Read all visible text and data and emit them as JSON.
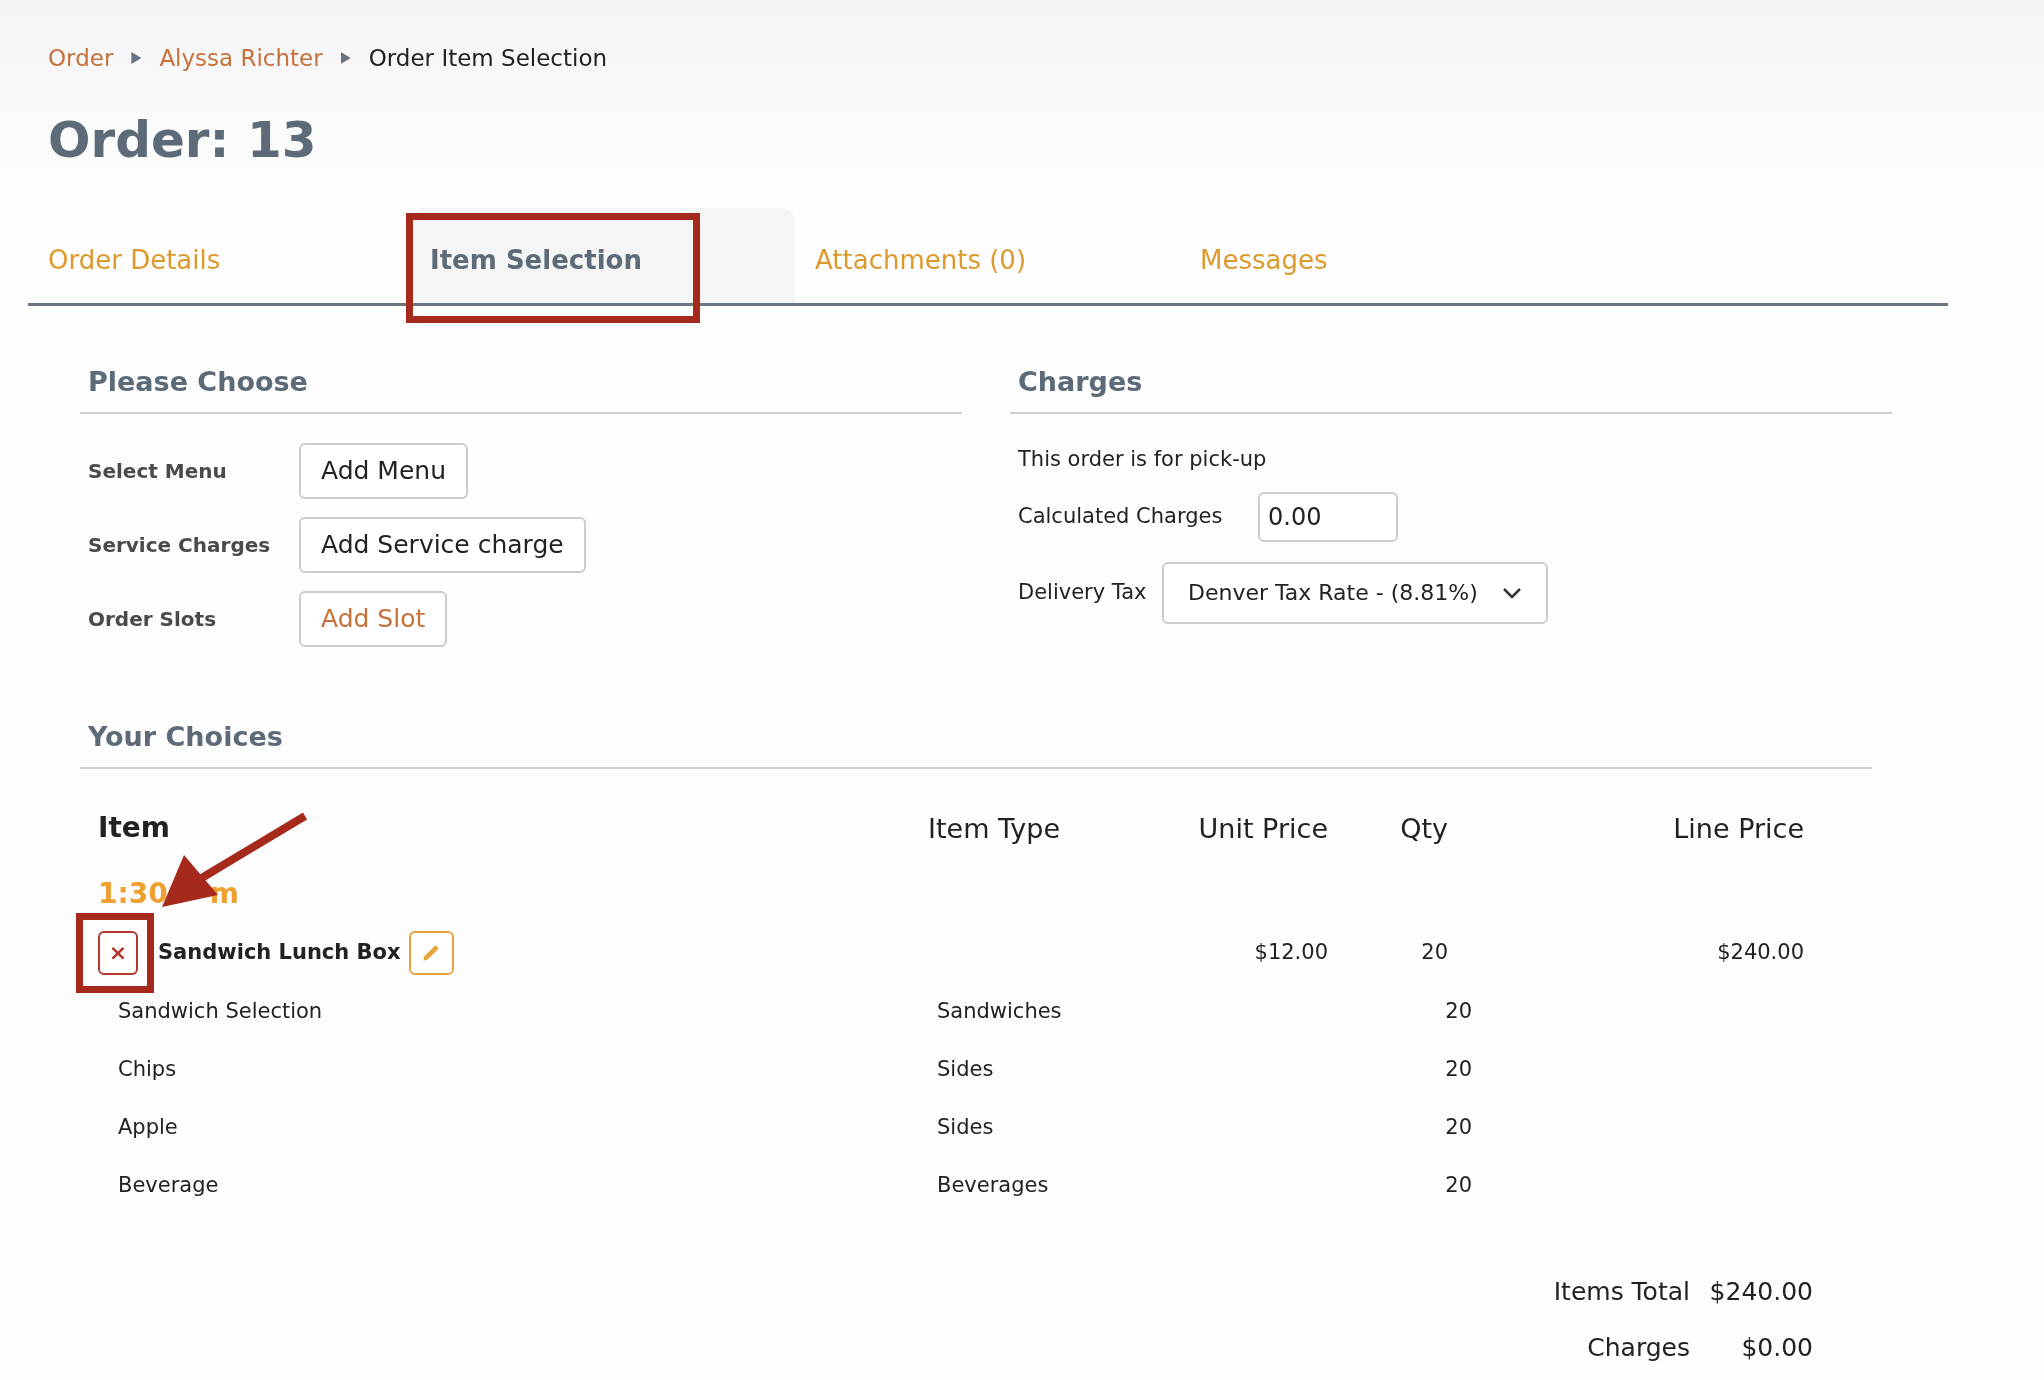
{
  "breadcrumb": [
    {
      "label": "Order",
      "kind": "link"
    },
    {
      "label": "Alyssa Richter",
      "kind": "link"
    },
    {
      "label": "Order Item Selection",
      "kind": "current"
    }
  ],
  "title": "Order: 13",
  "tabs": [
    {
      "label": "Order Details",
      "selected": false,
      "highlighted": false
    },
    {
      "label": "Item Selection",
      "selected": true,
      "highlighted": true
    },
    {
      "label": "Attachments (0)",
      "selected": false,
      "highlighted": false
    },
    {
      "label": "Messages",
      "selected": false,
      "highlighted": false
    }
  ],
  "please_choose": {
    "heading": "Please Choose",
    "rows": [
      {
        "label": "Select Menu",
        "button": "Add Menu",
        "kind": "default"
      },
      {
        "label": "Service Charges",
        "button": "Add Service charge",
        "kind": "default"
      },
      {
        "label": "Order Slots",
        "button": "Add Slot",
        "kind": "accent"
      }
    ]
  },
  "charges": {
    "heading": "Charges",
    "note": "This order is for pick-up",
    "calculated": {
      "label": "Calculated Charges",
      "value": "0.00"
    },
    "tax": {
      "label": "Delivery Tax",
      "value": "Denver Tax Rate - (8.81%)"
    }
  },
  "choices": {
    "heading": "Your Choices",
    "columns": [
      "Item",
      "Item Type",
      "Unit Price",
      "Qty",
      "Line Price"
    ],
    "slot": {
      "start": "1:30",
      "end": "m"
    },
    "item": {
      "name": "Sandwich Lunch Box",
      "unit_price": "$12.00",
      "qty": "20",
      "line_price": "$240.00",
      "remove_highlighted": true,
      "remove_label": "×",
      "components": [
        {
          "name": "Sandwich Selection",
          "type": "Sandwiches",
          "qty": "20"
        },
        {
          "name": "Chips",
          "type": "Sides",
          "qty": "20"
        },
        {
          "name": "Apple",
          "type": "Sides",
          "qty": "20"
        },
        {
          "name": "Beverage",
          "type": "Beverages",
          "qty": "20"
        }
      ]
    },
    "totals": [
      {
        "label": "Items Total",
        "value": "$240.00"
      },
      {
        "label": "Charges",
        "value": "$0.00"
      }
    ]
  }
}
